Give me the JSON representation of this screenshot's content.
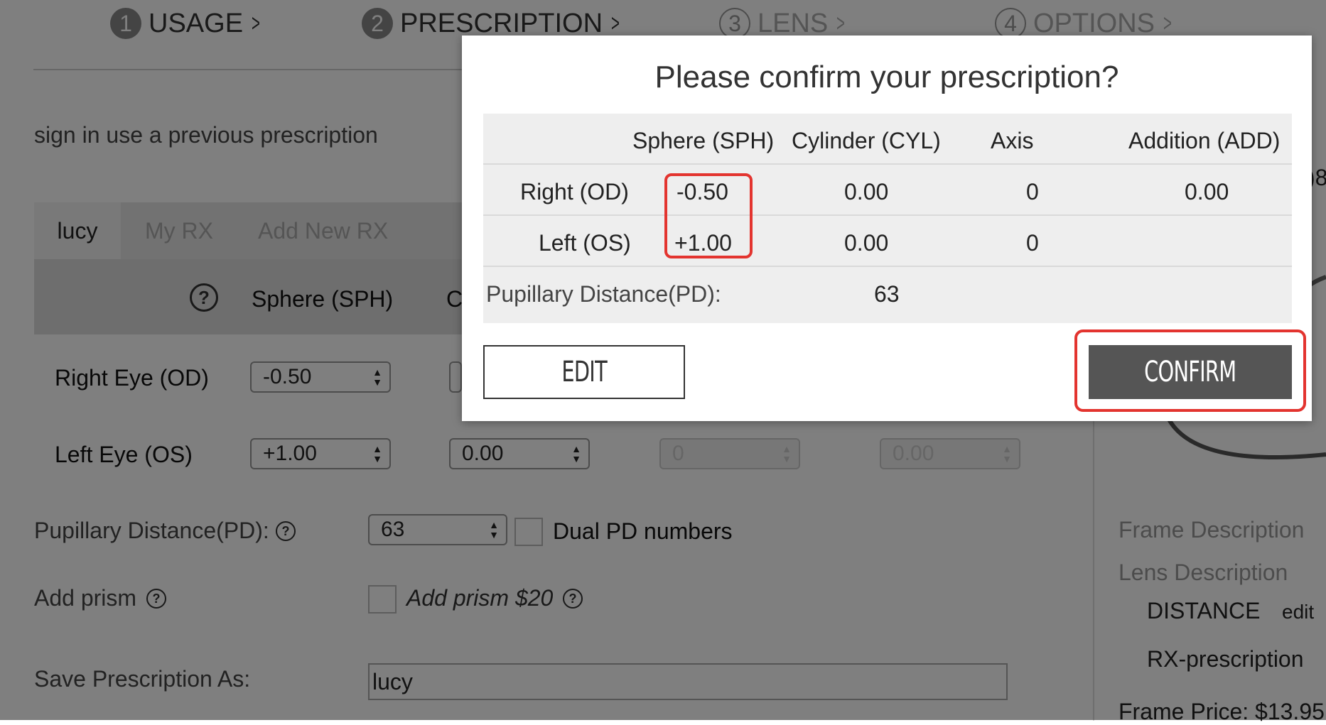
{
  "steps": [
    {
      "num": "1",
      "label": "USAGE"
    },
    {
      "num": "2",
      "label": "PRESCRIPTION"
    },
    {
      "num": "3",
      "label": "LENS"
    },
    {
      "num": "4",
      "label": "OPTIONS"
    }
  ],
  "chevron": ">",
  "signin_text": "sign in use a previous prescription",
  "tabs": [
    "lucy",
    "My RX",
    "Add New RX"
  ],
  "form": {
    "help_glyph": "?",
    "col_sph": "Sphere (SPH)",
    "col_cyl_partial": "C",
    "right_eye_label": "Right Eye (OD)",
    "left_eye_label": "Left Eye (OS)",
    "right_sph": "-0.50",
    "left_sph": "+1.00",
    "left_cyl": "0.00",
    "left_axis": "0",
    "left_add": "0.00",
    "pd_label": "Pupillary Distance(PD):",
    "pd_value": "63",
    "dual_pd_label": "Dual PD numbers",
    "prism_label": "Add prism",
    "prism_option": "Add prism $20",
    "save_label": "Save Prescription As:",
    "save_value": "lucy"
  },
  "sidebar": {
    "partial_edge": ")8",
    "frame_desc": "Frame Description",
    "lens_desc": "Lens Description",
    "distance": "DISTANCE",
    "edit": "edit",
    "rx": "RX-prescription",
    "frame_price": "Frame Price: $13.95"
  },
  "modal": {
    "title": "Please confirm your prescription?",
    "headers": [
      "Sphere (SPH)",
      "Cylinder (CYL)",
      "Axis",
      "Addition (ADD)"
    ],
    "right_label": "Right (OD)",
    "right_values": [
      "-0.50",
      "0.00",
      "0",
      "0.00"
    ],
    "left_label": "Left (OS)",
    "left_values": [
      "+1.00",
      "0.00",
      "0"
    ],
    "pd_label": "Pupillary Distance(PD):",
    "pd_value": "63",
    "edit_label": "EDIT",
    "confirm_label": "CONFIRM"
  },
  "colors": {
    "highlight": "#e3342f",
    "confirm_bg": "#555555",
    "overlay": "rgba(0,0,0,0.5)"
  }
}
